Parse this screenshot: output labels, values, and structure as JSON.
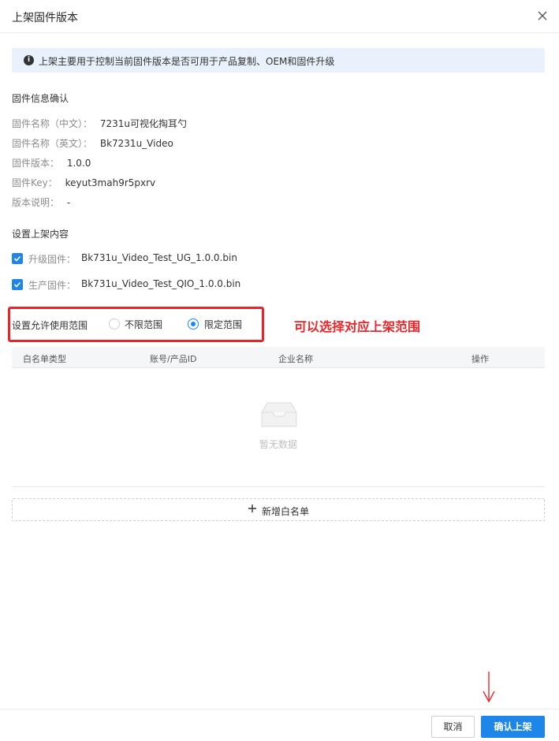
{
  "dialog": {
    "title": "上架固件版本",
    "close_icon": "close-icon"
  },
  "notice": {
    "icon": "info-icon",
    "text": "上架主要用于控制当前固件版本是否可用于产品复制、OEM和固件升级"
  },
  "firmware_info": {
    "section_title": "固件信息确认",
    "rows": [
      {
        "label": "固件名称（中文）：",
        "value": "7231u可视化掏耳勺"
      },
      {
        "label": "固件名称（英文）：",
        "value": "Bk7231u_Video"
      },
      {
        "label": "固件版本：",
        "value": "1.0.0"
      },
      {
        "label": "固件Key：",
        "value": "keyut3mah9r5pxrv"
      },
      {
        "label": "版本说明：",
        "value": "-"
      }
    ]
  },
  "publish_content": {
    "section_title": "设置上架内容",
    "items": [
      {
        "label": "升级固件：",
        "value": "Bk731u_Video_Test_UG_1.0.0.bin",
        "checked": true
      },
      {
        "label": "生产固件：",
        "value": "Bk731u_Video_Test_QIO_1.0.0.bin",
        "checked": true
      }
    ]
  },
  "scope": {
    "label": "设置允许使用范围",
    "options": [
      {
        "label": "不限范围",
        "selected": false
      },
      {
        "label": "限定范围",
        "selected": true
      }
    ],
    "annotation": "可以选择对应上架范围"
  },
  "whitelist_table": {
    "columns": [
      "白名单类型",
      "账号/产品ID",
      "企业名称",
      "操作"
    ],
    "empty_text": "暂无数据",
    "empty_icon": "inbox-icon",
    "add_button": "新增白名单",
    "add_icon": "plus-icon"
  },
  "footer": {
    "cancel": "取消",
    "confirm": "确认上架",
    "arrow_icon": "down-arrow-icon"
  },
  "colors": {
    "primary": "#1f86e9",
    "annotation_red": "#e8262a",
    "notice_bg": "#e8f1fc"
  }
}
